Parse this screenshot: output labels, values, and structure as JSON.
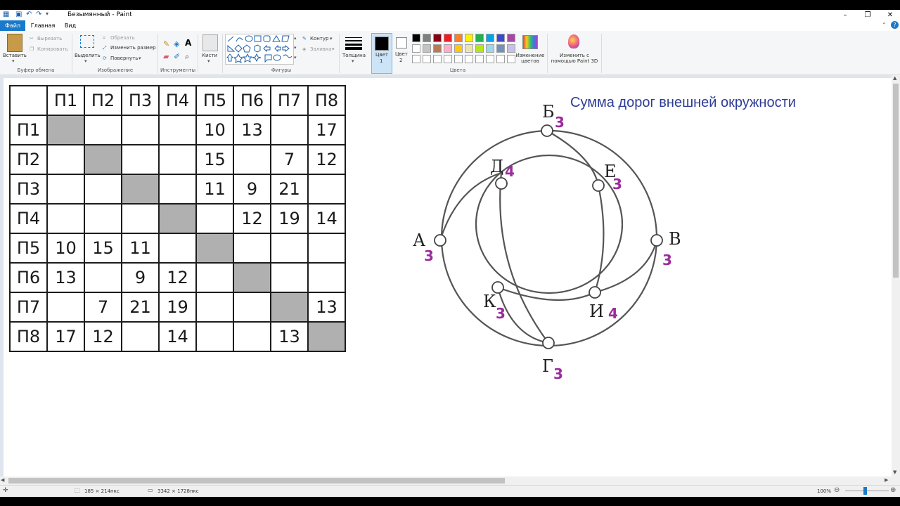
{
  "window": {
    "title": "Безымянный - Paint",
    "controls": {
      "minimize": "–",
      "maximize": "❐",
      "close": "✕"
    }
  },
  "menu": {
    "tabs": [
      "Файл",
      "Главная",
      "Вид"
    ]
  },
  "ribbon": {
    "clipboard": {
      "paste": "Вставить",
      "cut": "Вырезать",
      "copy": "Копировать",
      "label": "Буфер обмена"
    },
    "image": {
      "select": "Выделить",
      "crop": "Обрезать",
      "resize": "Изменить размер",
      "rotate": "Повернуть",
      "label": "Изображение"
    },
    "tools": {
      "label": "Инструменты"
    },
    "brushes": {
      "label": "Кисти"
    },
    "shapes": {
      "outline": "Контур",
      "fill": "Заливка",
      "label": "Фигуры"
    },
    "size": {
      "label": "Толщина"
    },
    "color1": {
      "label": "Цвет",
      "num": "1"
    },
    "color2": {
      "label": "Цвет",
      "num": "2"
    },
    "colors": {
      "label": "Цвета",
      "palette": [
        "#000000",
        "#7f7f7f",
        "#880015",
        "#ed1c24",
        "#ff7f27",
        "#fff200",
        "#22b14c",
        "#00a2e8",
        "#3f48cc",
        "#a349a4",
        "#ffffff",
        "#c3c3c3",
        "#b97a57",
        "#ffaec9",
        "#ffc90e",
        "#efe4b0",
        "#b5e61d",
        "#99d9ea",
        "#7092be",
        "#c8bfe7"
      ]
    },
    "edit_colors": "Изменение цветов",
    "paint3d": "Изменить с помощью Paint 3D"
  },
  "table": {
    "headers": [
      "",
      "П1",
      "П2",
      "П3",
      "П4",
      "П5",
      "П6",
      "П7",
      "П8"
    ],
    "rows": [
      [
        "П1",
        "",
        "",
        "",
        "",
        "10",
        "13",
        "",
        "17"
      ],
      [
        "П2",
        "",
        "",
        "",
        "",
        "15",
        "",
        "7",
        "12"
      ],
      [
        "П3",
        "",
        "",
        "",
        "",
        "11",
        "9",
        "21",
        ""
      ],
      [
        "П4",
        "",
        "",
        "",
        "",
        "",
        "12",
        "19",
        "14"
      ],
      [
        "П5",
        "10",
        "15",
        "11",
        "",
        "",
        "",
        "",
        ""
      ],
      [
        "П6",
        "13",
        "",
        "9",
        "12",
        "",
        "",
        "",
        ""
      ],
      [
        "П7",
        "",
        "7",
        "21",
        "19",
        "",
        "",
        "",
        "13"
      ],
      [
        "П8",
        "17",
        "12",
        "",
        "14",
        "",
        "",
        "13",
        ""
      ]
    ]
  },
  "annotation": "Сумма дорог внешней окружности",
  "graph_labels": {
    "B": "Б",
    "E": "Е",
    "D": "Д",
    "A": "А",
    "V": "В",
    "K": "К",
    "I": "И",
    "G": "Г"
  },
  "handwritten": {
    "B": "3",
    "E": "3",
    "D": "4",
    "A": "3",
    "V": "3",
    "K": "3",
    "I": "4",
    "G": "3"
  },
  "status": {
    "cursor": "185 × 214пкс",
    "size": "3342 × 1728пкс",
    "zoom": "100%"
  },
  "colors": {
    "accent": "#1979ca",
    "annotation": "#2e3d95",
    "handwriting": "#9b2d9b"
  }
}
